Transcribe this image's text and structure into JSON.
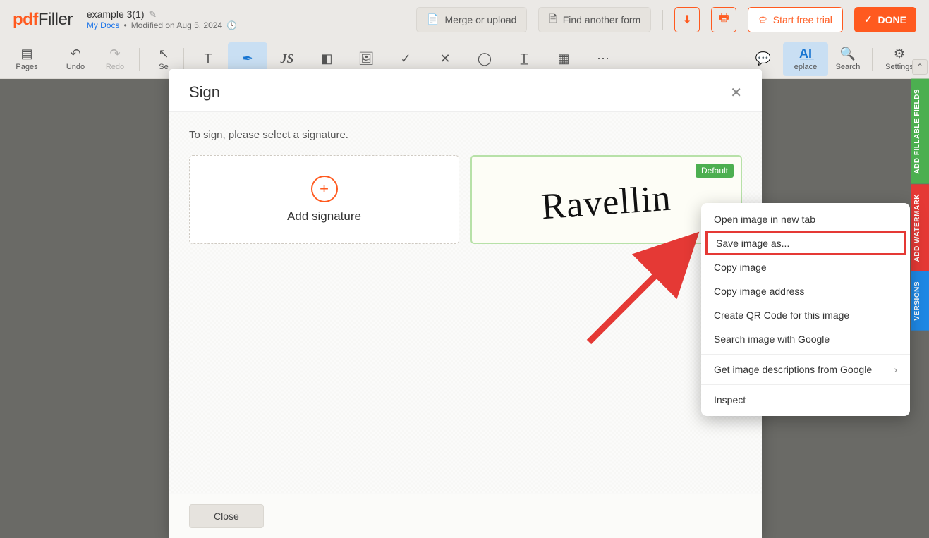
{
  "app": {
    "logo_bold": "pdf",
    "logo_thin": "Filler"
  },
  "doc": {
    "title": "example 3(1)",
    "link": "My Docs",
    "dot": "•",
    "modified": "Modified on Aug 5, 2024"
  },
  "header_buttons": {
    "merge": "Merge or upload",
    "find": "Find another form",
    "trial": "Start free trial",
    "done": "DONE"
  },
  "toolbar": {
    "pages": "Pages",
    "undo": "Undo",
    "redo": "Redo",
    "select": "Se",
    "replace": "eplace",
    "search": "Search",
    "settings": "Settings"
  },
  "modal": {
    "title": "Sign",
    "prompt": "To sign, please select a signature.",
    "add": "Add signature",
    "default": "Default",
    "signature_text": "Ravellin",
    "close": "Close"
  },
  "context": {
    "open": "Open image in new tab",
    "save": "Save image as...",
    "copy": "Copy image",
    "copy_addr": "Copy image address",
    "qr": "Create QR Code for this image",
    "search": "Search image with Google",
    "desc": "Get image descriptions from Google",
    "inspect": "Inspect"
  },
  "side": {
    "t1": "ADD FILLABLE FIELDS",
    "t2": "ADD WATERMARK",
    "t3": "VERSIONS"
  }
}
